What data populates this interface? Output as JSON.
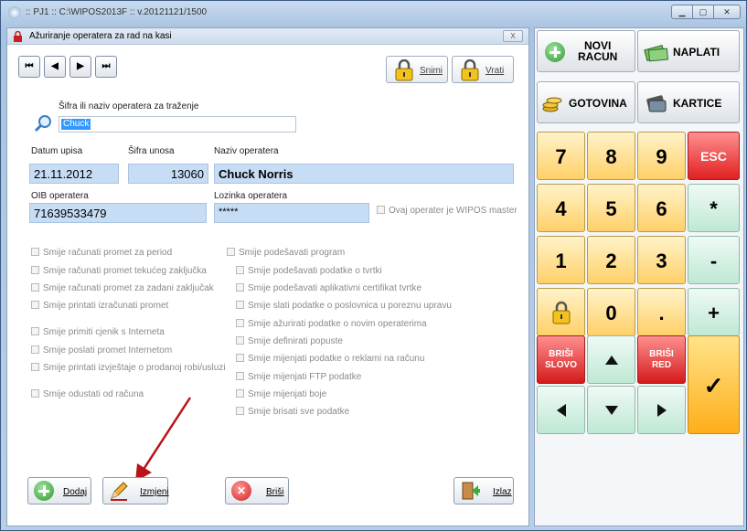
{
  "window": {
    "title": ":: PJ1 :: C:\\WIPOS2013F :: v.20121121/1500"
  },
  "dialog": {
    "title": "Ažuriranje operatera za rad na kasi",
    "close_label": "X",
    "nav": [
      "⏮",
      "◀",
      "▶",
      "⏭"
    ],
    "save_label": "Snimi",
    "revert_label": "Vrati"
  },
  "search": {
    "label": "Šifra ili naziv operatera za traženje",
    "value": "Chuck"
  },
  "form": {
    "datum_label": "Datum upisa",
    "datum_value": "21.11.2012",
    "sifra_label": "Šifra unosa",
    "sifra_value": "13060",
    "naziv_label": "Naziv operatera",
    "naziv_value": "Chuck Norris",
    "oib_label": "OIB operatera",
    "oib_value": "71639533479",
    "lozinka_label": "Lozinka operatera",
    "lozinka_value": "*****",
    "master_label": "Ovaj operater je WIPOS master"
  },
  "permissions_left": [
    "Smije računati promet za period",
    "Smije računati promet tekućeg zaključka",
    "Smije računati promet za zadani zaključak",
    "Smije printati izračunati promet",
    "Smije primiti cjenik s Interneta",
    "Smije poslati promet Internetom",
    "Smije printati izvještaje o prodanoj robi/usluzi",
    "Smije odustati od računa"
  ],
  "permissions_right": [
    "Smije podešavati program",
    "Smije podešavati podatke o tvrtki",
    "Smije podešavati aplikativni certifikat tvrtke",
    "Smije slati podatke o poslovnica u poreznu upravu",
    "Smije ažurirati podatke o novim operaterima",
    "Smije definirati popuste",
    "Smije mijenjati podatke o reklami na računu",
    "Smije mijenjati FTP podatke",
    "Smije mijenjati boje",
    "Smije brisati sve podatke"
  ],
  "actions": {
    "add_label": "Dodaj",
    "edit_label": "Izmjeni",
    "delete_label": "Briši",
    "exit_label": "Izlaz"
  },
  "keypad": {
    "new_invoice": "NOVI\nRACUN",
    "pay": "NAPLATI",
    "cash": "GOTOVINA",
    "cards": "KARTICE",
    "esc": "ESC",
    "digits": [
      "7",
      "8",
      "9",
      "4",
      "5",
      "6",
      "1",
      "2",
      "3",
      "0"
    ],
    "dot": ".",
    "multiply": "*",
    "minus": "-",
    "plus": "+",
    "delete_char": "BRIŠI\nSLOVO",
    "delete_row": "BRIŠI\nRED",
    "enter": "✓"
  }
}
